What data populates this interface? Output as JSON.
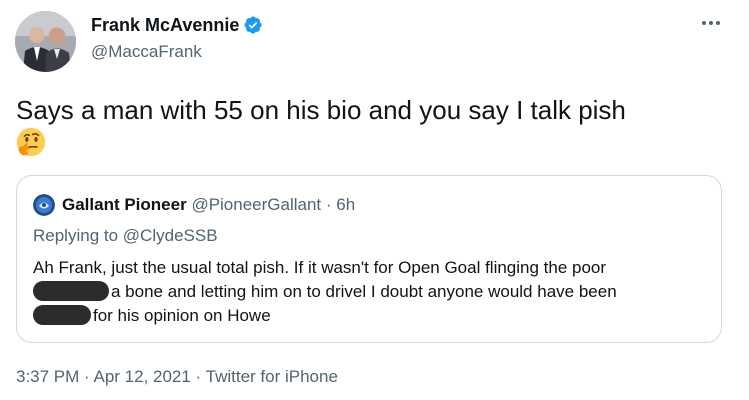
{
  "author": {
    "display_name": "Frank McAvennie",
    "handle": "@MaccaFrank",
    "verified": true
  },
  "tweet": {
    "text": "Says a man with 55 on his bio and you say I talk pish",
    "emoji": "thinking-face"
  },
  "quoted_tweet": {
    "display_name": "Gallant Pioneer",
    "handle": "@PioneerGallant",
    "separator": "·",
    "time": "6h",
    "replying_prefix": "Replying to",
    "replying_to": "@ClydeSSB",
    "body_line1": "Ah Frank, just the usual total pish. If it wasn't for Open Goal flinging the poor",
    "body_line2": "a bone and letting him on to drivel I doubt anyone would have been",
    "body_line3": "for his opinion on Howe"
  },
  "meta": {
    "timestamp": "3:37 PM · Apr 12, 2021 · Twitter for iPhone"
  },
  "colors": {
    "verified_badge": "#1d9bf0",
    "secondary_text": "#536471",
    "border": "#cfd9de"
  }
}
